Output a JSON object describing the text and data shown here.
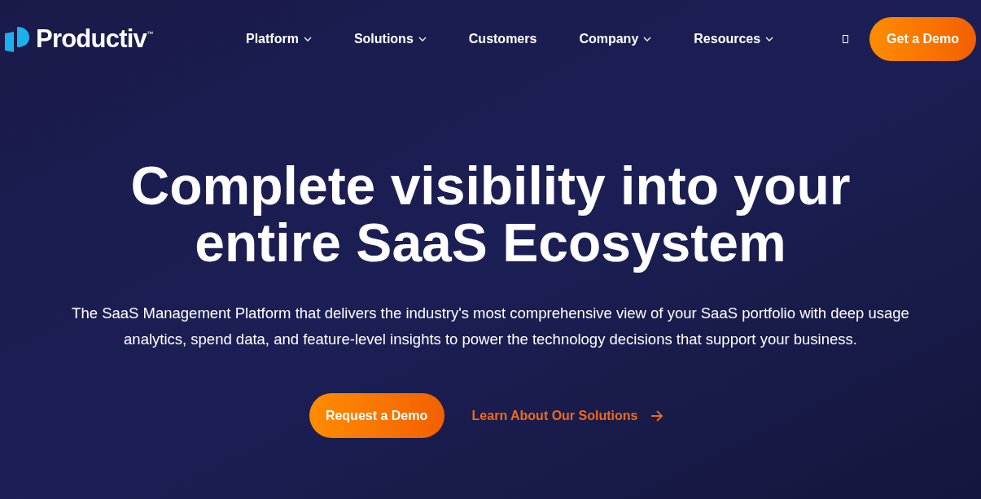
{
  "header": {
    "logo": {
      "name": "Productiv",
      "mark": "™"
    },
    "nav": [
      {
        "label": "Platform",
        "dropdown": true
      },
      {
        "label": "Solutions",
        "dropdown": true
      },
      {
        "label": "Customers",
        "dropdown": false
      },
      {
        "label": "Company",
        "dropdown": true
      },
      {
        "label": "Resources",
        "dropdown": true
      }
    ],
    "cta": "Get a Demo"
  },
  "hero": {
    "title_lines": [
      "Complete visibility into your",
      "entire SaaS Ecosystem"
    ],
    "subtitle": "The SaaS Management Platform that delivers the industry's most comprehensive view of your SaaS portfolio with deep usage analytics, spend data, and feature-level insights to power the technology decisions that support your business.",
    "primary_button": "Request a Demo",
    "secondary_link": "Learn About Our Solutions"
  }
}
